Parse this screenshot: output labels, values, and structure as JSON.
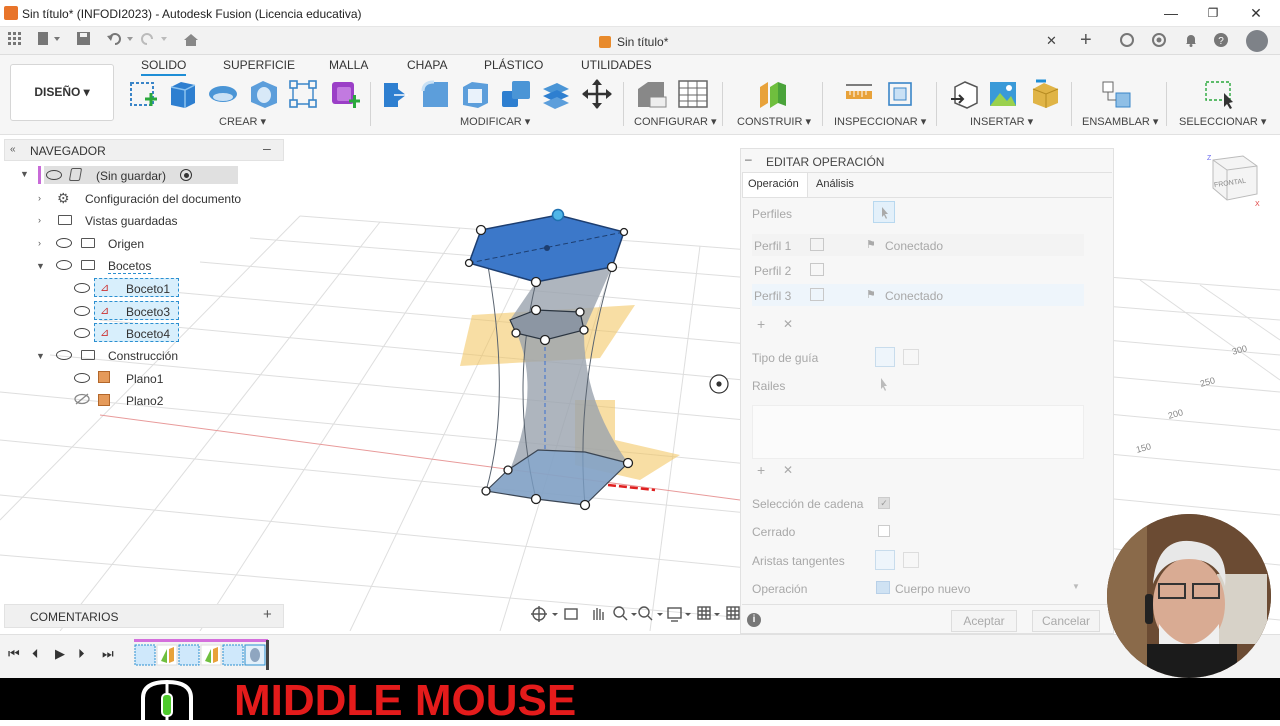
{
  "window": {
    "title": "Sin título* (INFODI2023) - Autodesk Fusion (Licencia educativa)",
    "min": "—",
    "max": "❐",
    "close": "✕"
  },
  "tabbar": {
    "doc_tab": "Sin título*",
    "close": "✕",
    "add": "+"
  },
  "ribbon": {
    "design_button": "DISEÑO ▾",
    "tabs": [
      "SOLIDO",
      "SUPERFICIE",
      "MALLA",
      "CHAPA",
      "PLÁSTICO",
      "UTILIDADES"
    ],
    "groups": {
      "crear": "CREAR ▾",
      "modificar": "MODIFICAR ▾",
      "configurar": "CONFIGURAR ▾",
      "construir": "CONSTRUIR ▾",
      "inspeccionar": "INSPECCIONAR ▾",
      "insertar": "INSERTAR ▾",
      "ensamblar": "ENSAMBLAR ▾",
      "seleccionar": "SELECCIONAR ▾"
    }
  },
  "navigator": {
    "title": "NAVEGADOR",
    "collapse": "–",
    "root": "(Sin guardar)",
    "items": [
      {
        "label": "Configuración del documento"
      },
      {
        "label": "Vistas guardadas"
      },
      {
        "label": "Origen"
      },
      {
        "label": "Bocetos"
      },
      {
        "label": "Boceto1"
      },
      {
        "label": "Boceto3"
      },
      {
        "label": "Boceto4"
      },
      {
        "label": "Construcción"
      },
      {
        "label": "Plano1"
      },
      {
        "label": "Plano2"
      }
    ]
  },
  "comments": {
    "label": "COMENTARIOS",
    "add": "+"
  },
  "panel": {
    "title": "EDITAR OPERACIÓN",
    "tabs": [
      "Operación",
      "Análisis"
    ],
    "profiles_label": "Perfiles",
    "profiles": [
      {
        "name": "Perfil 1",
        "status": "Conectado"
      },
      {
        "name": "Perfil 2",
        "status": ""
      },
      {
        "name": "Perfil 3",
        "status": "Conectado"
      }
    ],
    "guide_type_label": "Tipo de guía",
    "rails_label": "Railes",
    "chain_selection_label": "Selección de cadena",
    "closed_label": "Cerrado",
    "tangent_edges_label": "Aristas tangentes",
    "operation_label": "Operación",
    "operation_value": "Cuerpo nuevo",
    "accept": "Aceptar",
    "cancel": "Cancelar"
  },
  "viewcube": {
    "face": "FRONTAL"
  },
  "grid_labels": [
    "300",
    "250",
    "200",
    "150"
  ],
  "overlay": {
    "text": "MIDDLE MOUSE"
  },
  "colors": {
    "accent": "#1e8ed6",
    "solid_blue": "#3a78c8",
    "plane_orange": "#f0b040",
    "overlay_red": "#e41b1b"
  }
}
